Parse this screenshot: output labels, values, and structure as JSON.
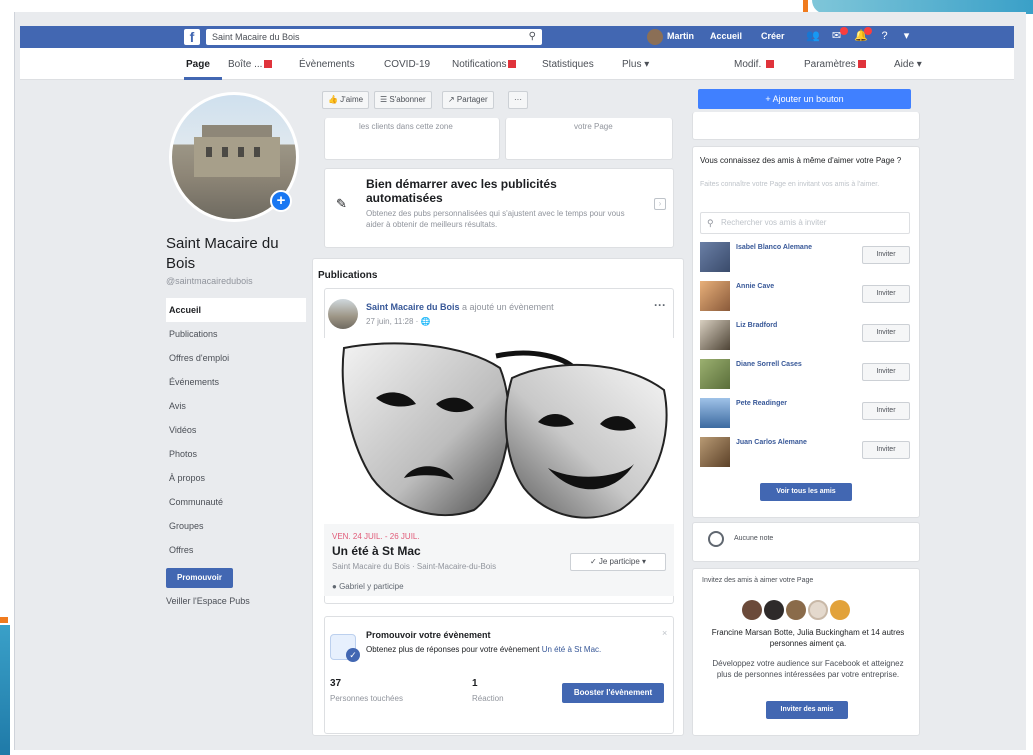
{
  "topbar": {
    "logo": "f",
    "search_value": "Saint Macaire du Bois",
    "user": "Martin",
    "home": "Accueil",
    "create": "Créer"
  },
  "pagenav": {
    "items": [
      "Page",
      "Boîte ...",
      "Évènements",
      "COVID-19",
      "Notifications",
      "Statistiques",
      "Plus ▾",
      "Modif.",
      "Paramètres",
      "Aide ▾"
    ]
  },
  "profile": {
    "name": "Saint Macaire du Bois",
    "handle": "@saintmacairedubois"
  },
  "left_nav": {
    "items": [
      "Accueil",
      "Publications",
      "Offres d'emploi",
      "Événements",
      "Avis",
      "Vidéos",
      "Photos",
      "À propos",
      "Communauté",
      "Groupes",
      "Offres"
    ],
    "promote": "Promouvoir",
    "ad_center": "Veiller l'Espace Pubs"
  },
  "actions": {
    "like": "👍 J'aime",
    "follow": "☰ S'abonner",
    "share": "↗ Partager",
    "more": "···"
  },
  "top_cards": {
    "left_text": "les clients dans cette zone",
    "right_text": "votre Page"
  },
  "adtip": {
    "title": "Bien démarrer avec les publicités automatisées",
    "desc": "Obtenez des pubs personnalisées qui s'ajustent avec le temps pour vous aider à obtenir de meilleurs résultats."
  },
  "feed": {
    "section": "Publications",
    "author": "Saint Macaire du Bois",
    "action": "a ajouté un évènement",
    "meta": "27 juin, 11:28 · 🌐",
    "more": "···",
    "event": {
      "date": "VEN. 24 JUIL. - 26 JUIL.",
      "title": "Un été à St Mac",
      "sub": "Saint Macaire du Bois · Saint-Macaire-du-Bois",
      "interest": "Gabriel y participe",
      "button": "✓ Je participe ▾"
    }
  },
  "promo": {
    "title": "Promouvoir votre évènement",
    "desc": "Obtenez plus de réponses pour votre évènement",
    "link": "Un été à St Mac.",
    "close": "×",
    "stats": [
      {
        "num": "37",
        "label": "Personnes touchées"
      },
      {
        "num": "1",
        "label": "Réaction"
      }
    ],
    "boost": "Booster l'évènement"
  },
  "right": {
    "add_button": "+ Ajouter un bouton",
    "invite_title": "Vous connaissez des amis à même d'aimer votre Page ?",
    "invite_sub": "Faites connaître votre Page en invitant vos amis à l'aimer.",
    "search_placeholder": "Rechercher vos amis à inviter",
    "friends": [
      {
        "name": "Isabel Blanco Alemane",
        "invite": "Inviter"
      },
      {
        "name": "Annie Cave",
        "invite": "Inviter"
      },
      {
        "name": "Liz Bradford",
        "invite": "Inviter"
      },
      {
        "name": "Diane Sorrell Cases",
        "invite": "Inviter"
      },
      {
        "name": "Pete Readinger",
        "invite": "Inviter"
      },
      {
        "name": "Juan Carlos Alemane",
        "invite": "Inviter"
      }
    ],
    "see_all": "Voir tous les amis",
    "clock_text": "Aucune note",
    "invite_head": "Invitez des amis à aimer votre Page",
    "likers": "Francine Marsan Botte, Julia Buckingham et 14 autres personnes aiment ça.",
    "grow": "Développez votre audience sur Facebook et atteignez plus de personnes intéressées par votre entreprise.",
    "invite_friends": "Inviter des amis"
  },
  "colors": {
    "fb_blue": "#4267b2",
    "accent_blue": "#4080ff",
    "badge_red": "#e0333b",
    "event_date": "#e05a78"
  }
}
